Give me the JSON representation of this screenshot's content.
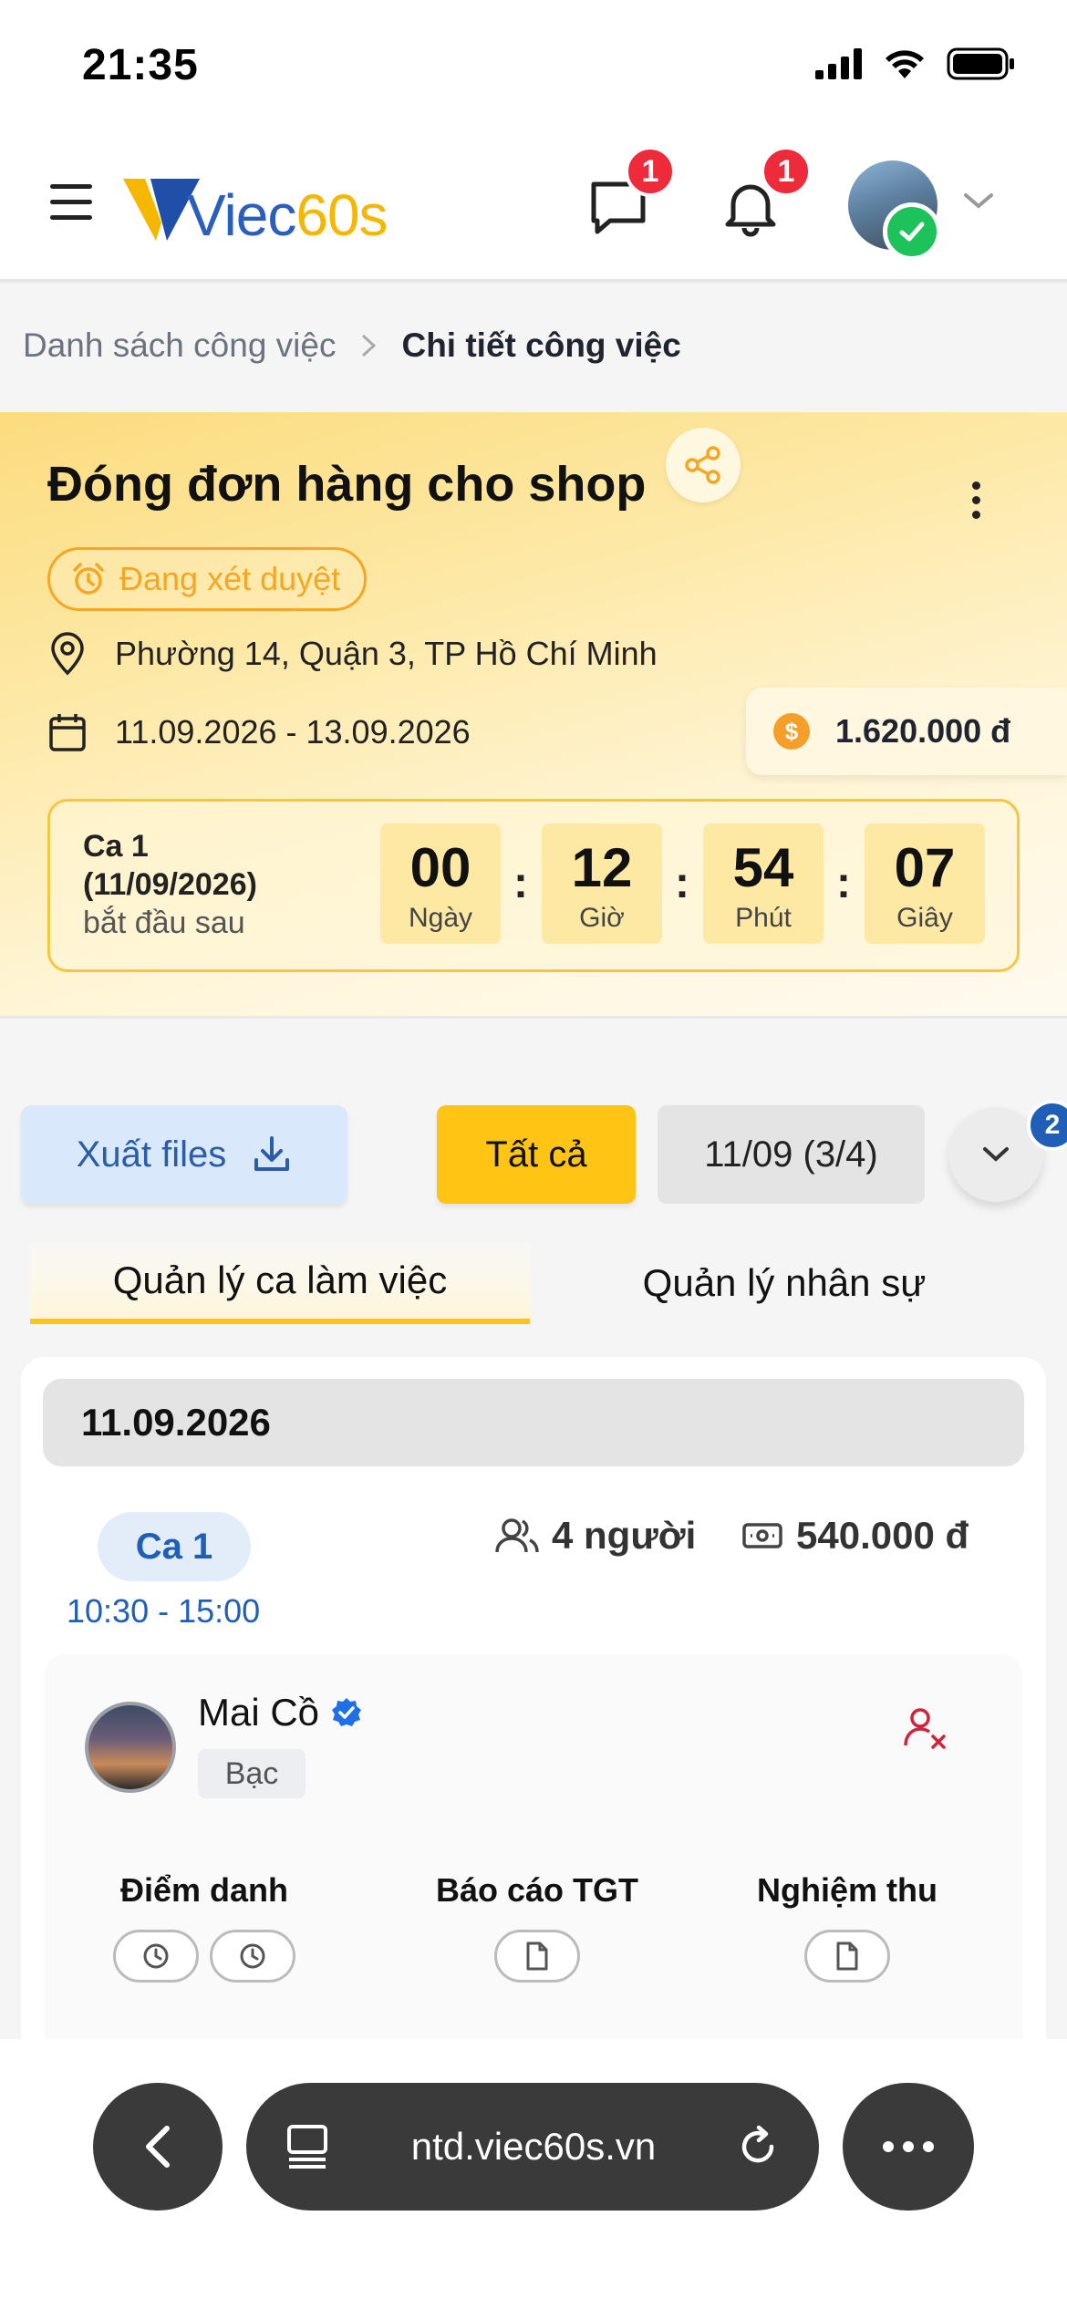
{
  "status_bar": {
    "time": "21:35"
  },
  "header": {
    "logo_text_main": "Viec",
    "logo_text_num": "60s",
    "messages_badge": "1",
    "notifications_badge": "1"
  },
  "breadcrumb": {
    "parent": "Danh sách công việc",
    "current": "Chi tiết công việc"
  },
  "job": {
    "title": "Đóng đơn hàng cho shop",
    "status": "Đang xét duyệt",
    "location": "Phường 14, Quận 3, TP Hồ Chí Minh",
    "date_range": "11.09.2026 - 13.09.2026",
    "salary": "1.620.000 đ",
    "countdown": {
      "shift_name": "Ca 1",
      "shift_date": "(11/09/2026)",
      "starts_label": "bắt đầu sau",
      "days": "00",
      "days_label": "Ngày",
      "hours": "12",
      "hours_label": "Giờ",
      "minutes": "54",
      "minutes_label": "Phút",
      "seconds": "07",
      "seconds_label": "Giây",
      "separator": ":"
    }
  },
  "actions": {
    "export_label": "Xuất files",
    "all_label": "Tất cả",
    "date_filter": "11/09 (3/4)",
    "more_badge": "2"
  },
  "tabs": {
    "shifts": "Quản lý ca làm việc",
    "staff": "Quản lý nhân sự"
  },
  "shift_section": {
    "date": "11.09.2026",
    "shift_name": "Ca 1",
    "shift_time": "10:30 - 15:00",
    "people": "4 người",
    "pay": "540.000 đ",
    "worker": {
      "name": "Mai Cồ",
      "rank": "Bạc",
      "col_attendance": "Điểm danh",
      "col_report": "Báo cáo TGT",
      "col_acceptance": "Nghiệm thu"
    }
  },
  "browser": {
    "url": "ntd.viec60s.vn"
  },
  "colors": {
    "brand_yellow": "#ffc414",
    "brand_blue": "#1f5fb8",
    "badge_red": "#ee2b3b",
    "status_orange": "#f5a623"
  }
}
